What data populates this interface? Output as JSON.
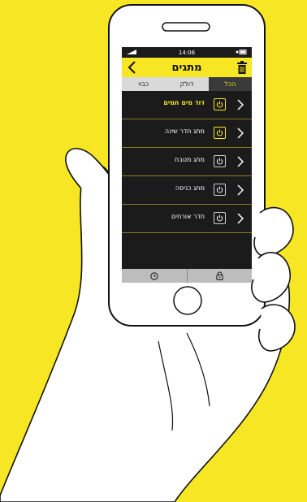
{
  "status_bar": {
    "time": "14:06"
  },
  "header": {
    "title": "מתגים",
    "back_icon": "chevron-left-icon",
    "trash_icon": "trash-icon"
  },
  "tabs": [
    {
      "label": "הכל",
      "active": true
    },
    {
      "label": "דולק",
      "active": false
    },
    {
      "label": "כבוי",
      "active": false
    }
  ],
  "switches": [
    {
      "label": "דוד מים חמים",
      "on": true
    },
    {
      "label": "מתג חדר שינה",
      "on": true
    },
    {
      "label": "מתג מטבח",
      "on": false
    },
    {
      "label": "מתג כניסה",
      "on": false
    },
    {
      "label": "חדר אורחים",
      "on": false
    }
  ],
  "bottom_bar": {
    "left_icon": "clock-icon",
    "right_icon": "lock-icon"
  },
  "colors": {
    "accent": "#f7e624",
    "screen_bg": "#1b1b1b",
    "background": "#f7e624"
  }
}
